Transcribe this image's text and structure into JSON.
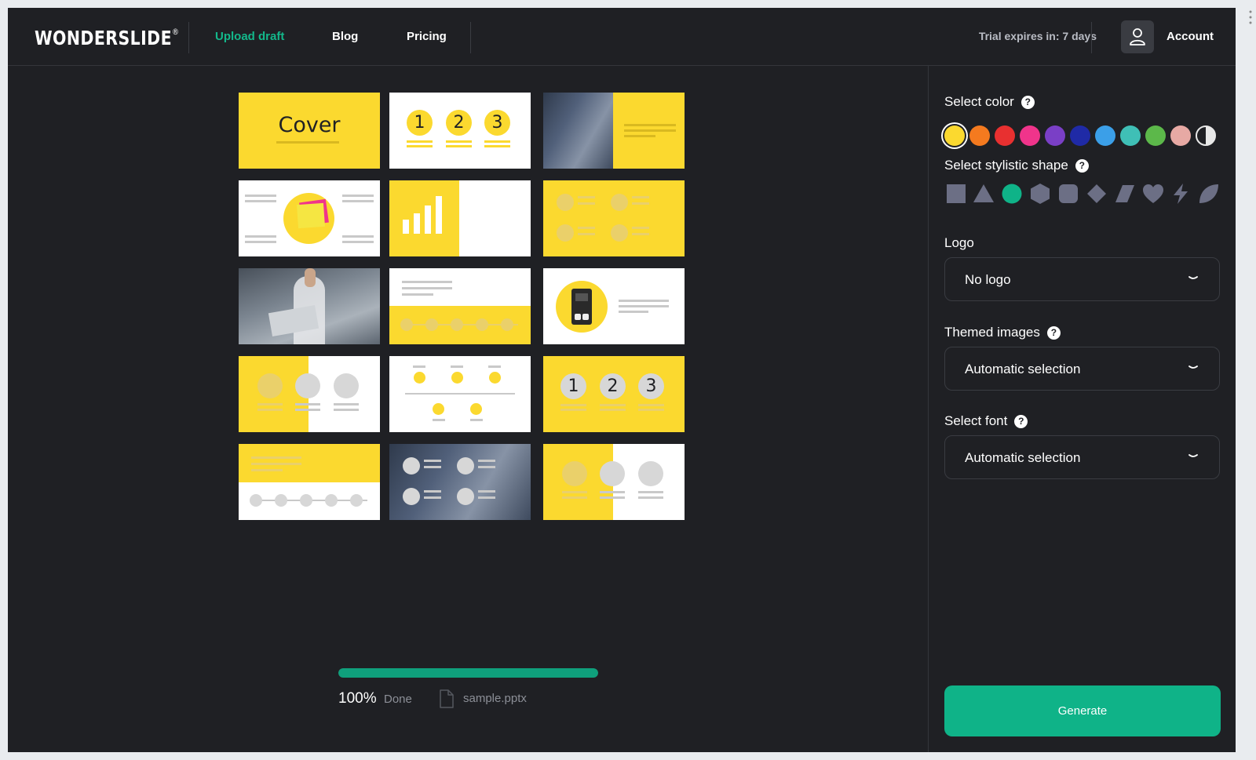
{
  "header": {
    "logo": "WONDERSLIDE",
    "logo_mark": "®",
    "nav": [
      {
        "label": "Upload draft",
        "active": true
      },
      {
        "label": "Blog",
        "active": false
      },
      {
        "label": "Pricing",
        "active": false
      }
    ],
    "trial_text": "Trial expires in: 7 days",
    "account_label": "Account",
    "avatar_icon": "user-icon"
  },
  "slides": {
    "cover_title": "Cover",
    "numbers_a": [
      "1",
      "2",
      "3"
    ],
    "numbers_b": [
      "1",
      "2",
      "3"
    ],
    "accent_color": "#fbd92f"
  },
  "panel": {
    "color_label": "Select color",
    "colors": [
      "#fbd92f",
      "#f47a1f",
      "#e83030",
      "#f0348b",
      "#7a3fc6",
      "#1f2aa6",
      "#3b9fe8",
      "#3fbfb6",
      "#5cb84a",
      "#e7a9a4",
      "#e8e8e8"
    ],
    "selected_color": "#fbd92f",
    "shape_label": "Select stylistic shape",
    "shapes": [
      "square",
      "triangle",
      "circle",
      "hexagon",
      "rounded-square",
      "diamond",
      "parallelogram",
      "heart",
      "lightning",
      "leaf"
    ],
    "selected_shape": "circle",
    "logo_label": "Logo",
    "logo_value": "No logo",
    "images_label": "Themed images",
    "images_value": "Automatic selection",
    "font_label": "Select font",
    "font_value": "Automatic selection",
    "help_glyph": "?",
    "generate_label": "Generate"
  },
  "progress": {
    "value": 1.0,
    "percent_text": "100%",
    "status": "Done",
    "file_name": "sample.pptx"
  }
}
